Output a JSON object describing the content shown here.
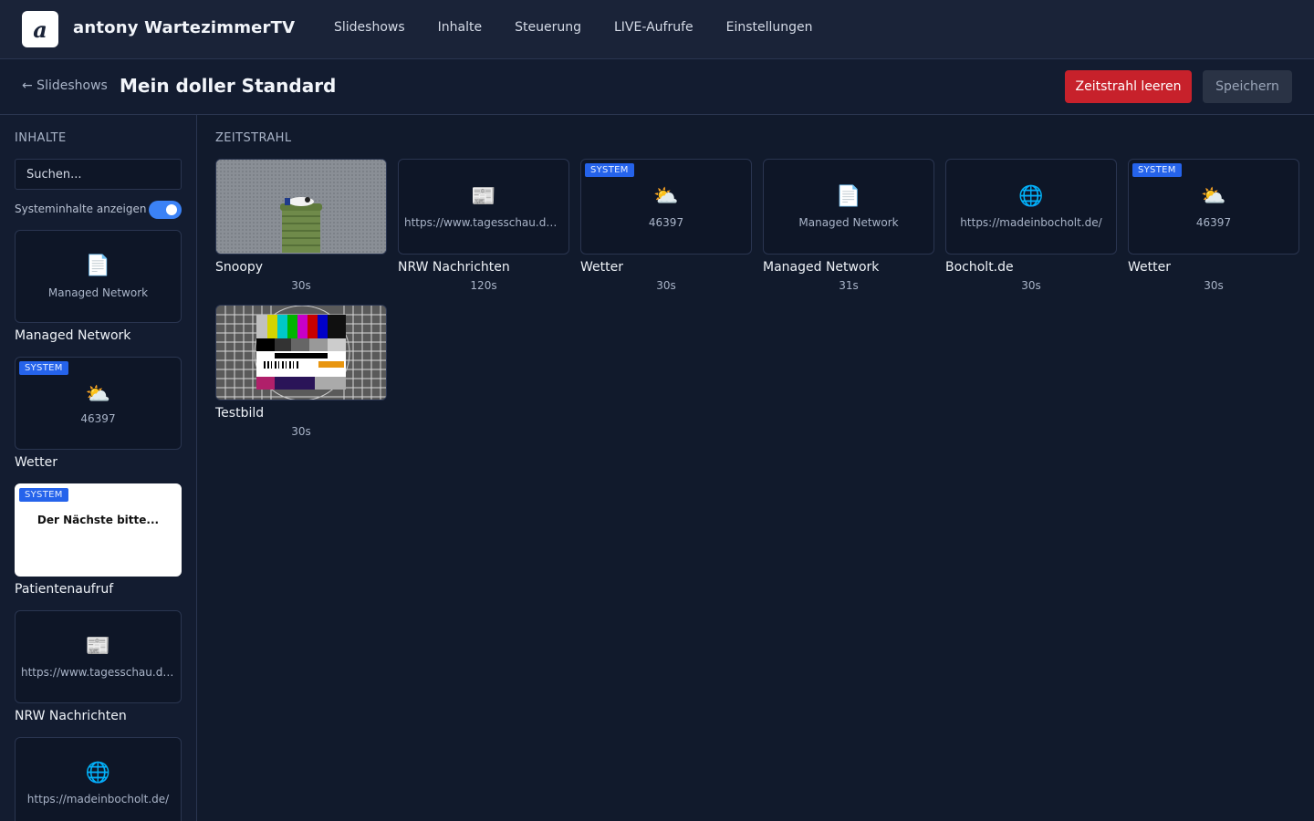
{
  "app": {
    "logo_letter": "a",
    "title": "antony WartezimmerTV"
  },
  "nav": [
    "Slideshows",
    "Inhalte",
    "Steuerung",
    "LIVE-Aufrufe",
    "Einstellungen"
  ],
  "subheader": {
    "back": "← Slideshows",
    "title": "Mein doller Standard",
    "clear_label": "Zeitstrahl leeren",
    "save_label": "Speichern"
  },
  "sidebar": {
    "heading": "INHALTE",
    "search_placeholder": "Suchen...",
    "toggle_label": "Systeminhalte anzeigen",
    "toggle_on": true,
    "items": [
      {
        "icon": "document-icon",
        "glyph": "📄",
        "sub": "Managed Network",
        "title": "Managed Network",
        "system": false
      },
      {
        "icon": "weather-icon",
        "glyph": "⛅",
        "sub": "46397",
        "title": "Wetter",
        "system": true
      },
      {
        "icon": "",
        "glyph": "",
        "sub": "Der Nächste bitte...",
        "title": "Patientenaufruf",
        "system": true
      },
      {
        "icon": "newspaper-icon",
        "glyph": "📰",
        "sub": "https://www.tagesschau.de...",
        "title": "NRW Nachrichten",
        "system": false
      },
      {
        "icon": "globe-icon",
        "glyph": "🌐",
        "sub": "https://madeinbocholt.de/",
        "title": "",
        "system": false
      }
    ]
  },
  "timeline": {
    "heading": "ZEITSTRAHL",
    "badge": "SYSTEM",
    "items": [
      {
        "title": "Snoopy",
        "duration": "30s",
        "kind": "image",
        "system": false
      },
      {
        "title": "NRW Nachrichten",
        "duration": "120s",
        "kind": "newspaper-icon",
        "glyph": "📰",
        "sub": "https://www.tagesschau.de/...",
        "system": false
      },
      {
        "title": "Wetter",
        "duration": "30s",
        "kind": "weather-icon",
        "glyph": "⛅",
        "sub": "46397",
        "system": true
      },
      {
        "title": "Managed Network",
        "duration": "31s",
        "kind": "document-icon",
        "glyph": "📄",
        "sub": "Managed Network",
        "system": false
      },
      {
        "title": "Bocholt.de",
        "duration": "30s",
        "kind": "globe-icon",
        "glyph": "🌐",
        "sub": "https://madeinbocholt.de/",
        "system": false
      },
      {
        "title": "Wetter",
        "duration": "30s",
        "kind": "weather-icon",
        "glyph": "⛅",
        "sub": "46397",
        "system": true
      },
      {
        "title": "Testbild",
        "duration": "30s",
        "kind": "testcard",
        "system": false
      }
    ]
  },
  "colors": {
    "accent": "#3b82f6",
    "danger": "#c7212b",
    "badge": "#2563eb",
    "bg": "#111a2c"
  }
}
